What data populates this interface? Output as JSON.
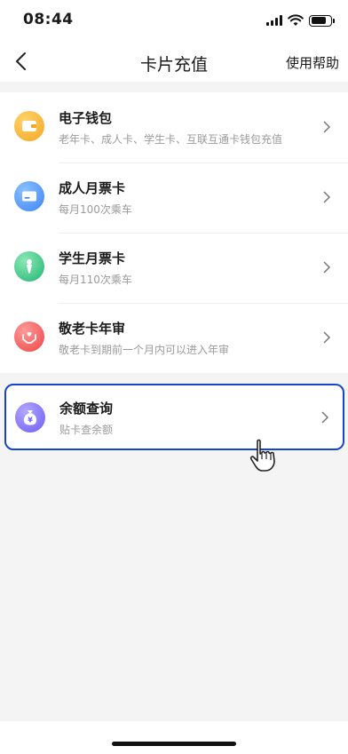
{
  "status_bar": {
    "time": "08:44",
    "icons": [
      "signal-icon",
      "wifi-icon",
      "battery-icon"
    ]
  },
  "nav": {
    "back_icon": "chevron-left-icon",
    "title": "卡片充值",
    "help_label": "使用帮助"
  },
  "items": [
    {
      "title": "电子钱包",
      "subtitle": "老年卡、成人卡、学生卡、互联互通卡钱包充值",
      "icon": "wallet-icon",
      "color": "#f5a623"
    },
    {
      "title": "成人月票卡",
      "subtitle": "每月100次乘车",
      "icon": "card-icon",
      "color": "#3b82f6"
    },
    {
      "title": "学生月票卡",
      "subtitle": "每月110次乘车",
      "icon": "pen-icon",
      "color": "#22b573"
    },
    {
      "title": "敬老卡年审",
      "subtitle": "敬老卡到期前一个月内可以进入年审",
      "icon": "heart-hands-icon",
      "color": "#ef4444"
    }
  ],
  "balance": {
    "title": "余额查询",
    "subtitle": "贴卡查余额",
    "icon": "money-bag-icon",
    "color": "#6d5cf6",
    "highlight_color": "#1446c6"
  },
  "pointer": {
    "icon": "hand-pointer-icon"
  }
}
